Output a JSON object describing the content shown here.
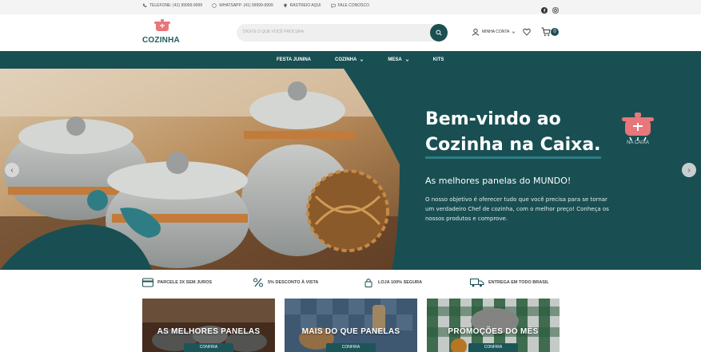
{
  "topbar": {
    "contacts": [
      {
        "icon": "phone-icon",
        "text": "TELEFONE: (41) 99999-9999"
      },
      {
        "icon": "whatsapp-icon",
        "text": "WHATSAPP: (41) 99999-9999"
      },
      {
        "icon": "location-icon",
        "text": "RASTREIO AQUI"
      },
      {
        "icon": "chat-icon",
        "text": "FALE CONOSCO"
      }
    ],
    "social": [
      "facebook-icon",
      "instagram-icon"
    ]
  },
  "header": {
    "logo_text": "COZINHA",
    "search_placeholder": "DIGITE O QUE VOCÊ PROCURA",
    "account_label": "MINHA CONTA",
    "cart_count": "0"
  },
  "nav": {
    "items": [
      {
        "label": "FESTA JUNINA",
        "dropdown": false
      },
      {
        "label": "COZINHA",
        "dropdown": true
      },
      {
        "label": "MESA",
        "dropdown": true
      },
      {
        "label": "KITS",
        "dropdown": false
      }
    ]
  },
  "hero": {
    "title_line1": "Bem-vindo ao",
    "title_line2": "Cozinha na Caixa.",
    "subtitle": "As melhores panelas do MUNDO!",
    "text": "O nosso objetivo é oferecer tudo que você precisa para se tornar um verdadeiro Chef de cozinha, com o melhor preço! Conheça os nossos produtos e comprove.",
    "logo_caption": "NA CAIXA",
    "prev": "‹",
    "next": "›"
  },
  "features": [
    {
      "icon": "card-icon",
      "text": "PARCELE 3X SEM JUROS"
    },
    {
      "icon": "percent-icon",
      "text": "5% DESCONTO À VISTA"
    },
    {
      "icon": "lock-icon",
      "text": "LOJA 100% SEGURA"
    },
    {
      "icon": "truck-icon",
      "text": "ENTREGA EM TODO BRASIL"
    }
  ],
  "banners": [
    {
      "label": "AS MELHORES PANELAS",
      "cta": "CONFIRA"
    },
    {
      "label": "MAIS DO QUE PANELAS",
      "cta": "CONFIRA"
    },
    {
      "label": "PROMOÇÕES DO MÊS",
      "cta": "CONFIRA"
    }
  ],
  "colors": {
    "brand": "#184f52",
    "accent": "#e8767a"
  }
}
